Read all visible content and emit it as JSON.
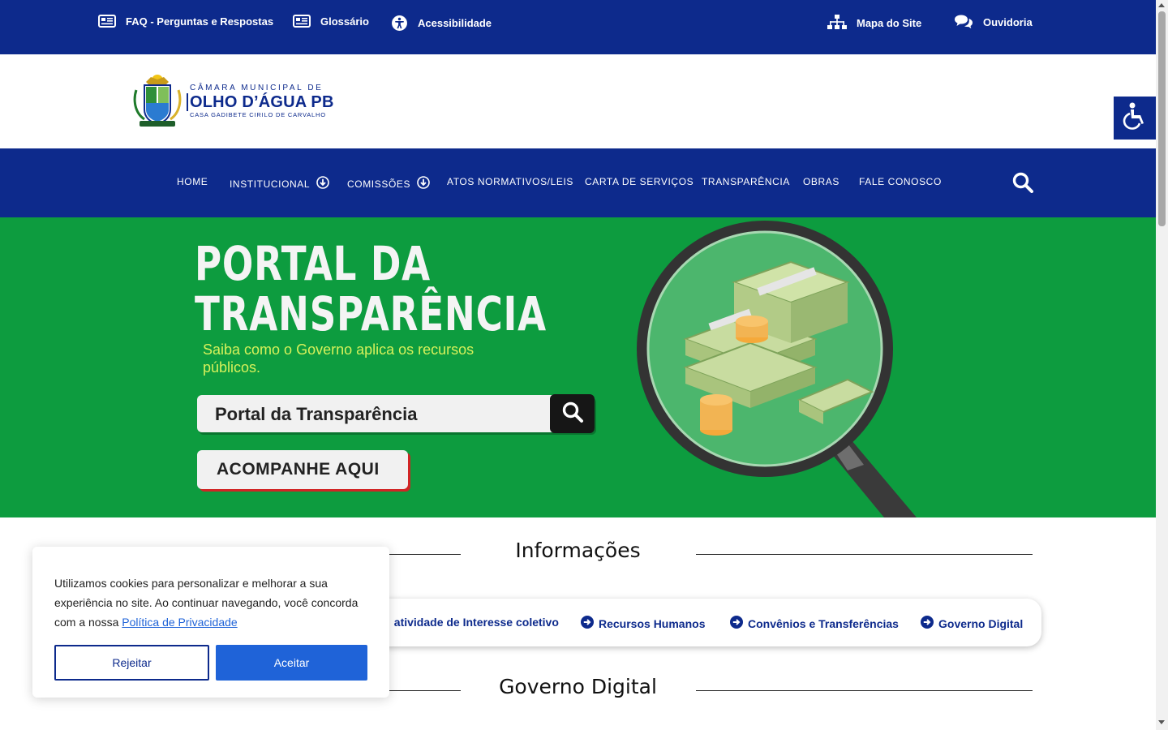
{
  "topbar": {
    "links": [
      {
        "label": "FAQ - Perguntas e Respostas",
        "icon": "newspaper-icon"
      },
      {
        "label": "Glossário",
        "icon": "newspaper-icon"
      },
      {
        "label": "Acessibilidade",
        "icon": "accessibility-icon"
      },
      {
        "label": "Mapa do Site",
        "icon": "sitemap-icon"
      },
      {
        "label": "Ouvidoria",
        "icon": "comments-icon"
      }
    ]
  },
  "header": {
    "brand_line1": "CÂMARA MUNICIPAL DE",
    "brand_line2": "OLHO D’ÁGUA PB",
    "brand_line3": "CASA GADIBETE CIRILO DE CARVALHO"
  },
  "nav": {
    "items": [
      {
        "label": "HOME"
      },
      {
        "label": "INSTITUCIONAL",
        "dropdown": true
      },
      {
        "label": "COMISSÕES",
        "dropdown": true
      },
      {
        "label": "ATOS NORMATIVOS/LEIS"
      },
      {
        "label": "CARTA DE SERVIÇOS"
      },
      {
        "label": "TRANSPARÊNCIA"
      },
      {
        "label": "OBRAS"
      },
      {
        "label": "FALE CONOSCO"
      }
    ],
    "search_icon": "search-icon"
  },
  "hero": {
    "title_line1": "PORTAL DA",
    "title_line2": "TRANSPARÊNCIA",
    "subtitle": "Saiba como o Governo aplica os recursos públicos.",
    "search_text": "Portal da Transparência",
    "cta": "ACOMPANHE AQUI"
  },
  "sections": {
    "info_title": "Informações",
    "gov_title": "Governo Digital"
  },
  "info_tabs": [
    {
      "label": "atividade de Interesse coletivo",
      "partial_prefix": "e"
    },
    {
      "label": "Recursos Humanos"
    },
    {
      "label": "Convênios e Transferências"
    },
    {
      "label": "Governo Digital"
    }
  ],
  "cookie": {
    "message": "Utilizamos cookies para personalizar e melhorar a sua experiência no site. Ao continuar navegando, você concorda com a nossa",
    "policy_link": "Política de Privacidade",
    "reject": "Rejeitar",
    "accept": "Aceitar"
  },
  "colors": {
    "brand_blue": "#0d2a8c",
    "hero_green": "#0d9c3f",
    "accent_blue": "#1f63d8",
    "subtitle_yellow": "#d7f15a"
  }
}
